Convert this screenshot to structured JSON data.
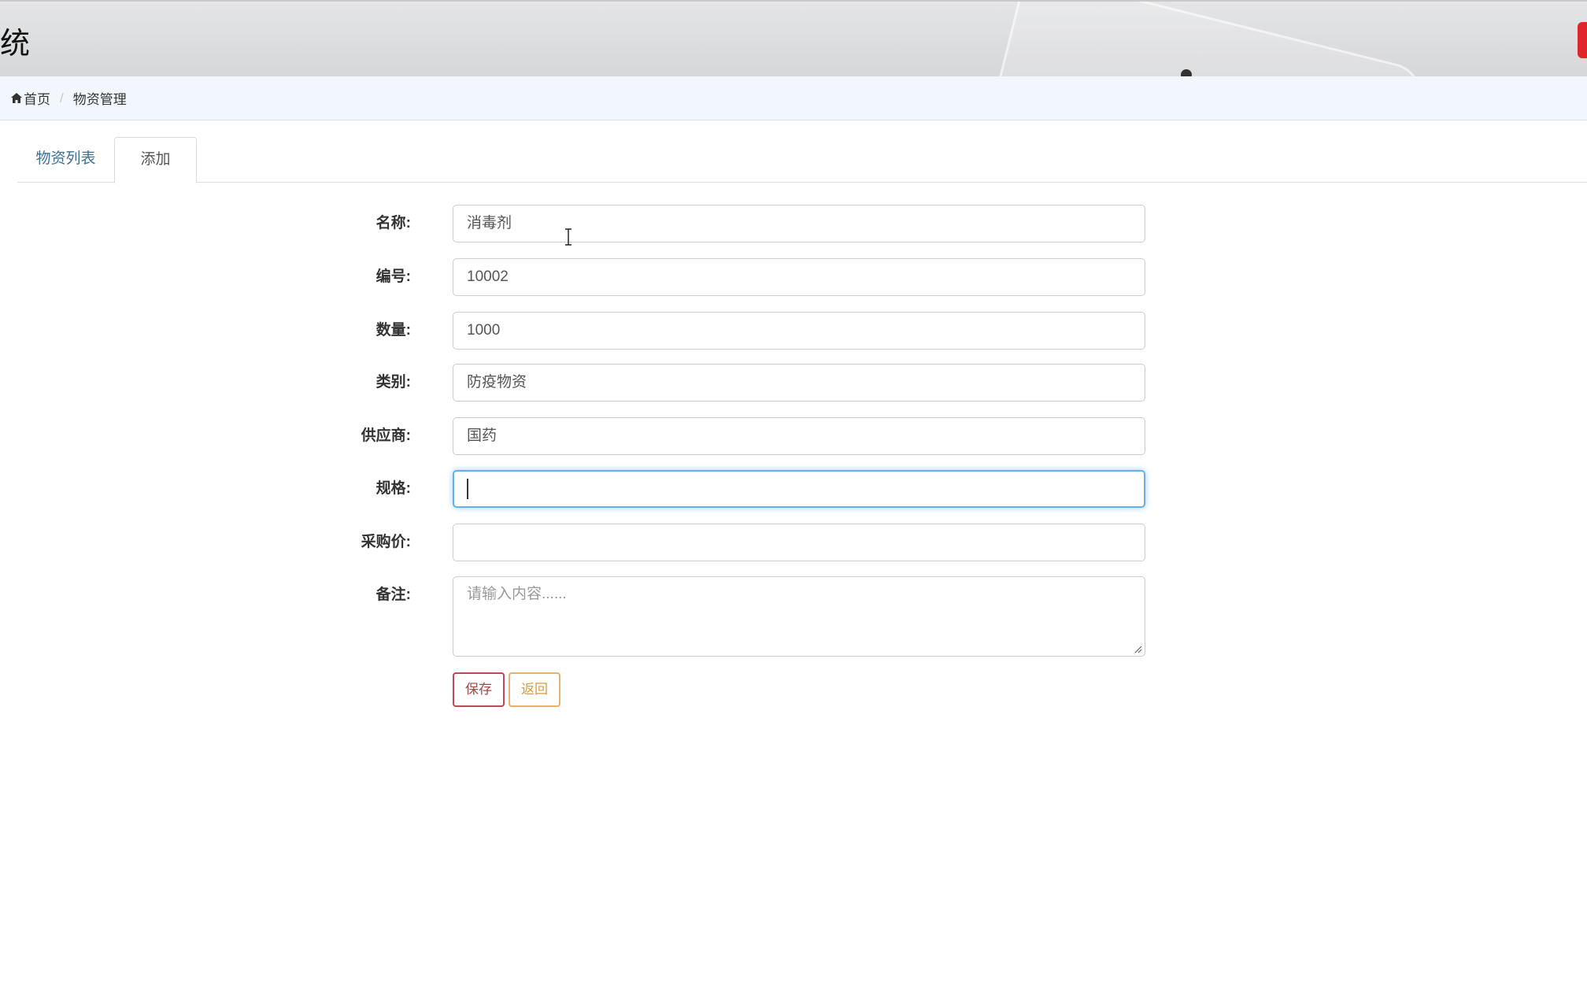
{
  "header": {
    "title_fragment": "统"
  },
  "breadcrumb": {
    "home": "首页",
    "current": "物资管理"
  },
  "tabs": {
    "list": "物资列表",
    "add": "添加"
  },
  "form": {
    "name": {
      "label": "名称:",
      "value": "消毒剂"
    },
    "code": {
      "label": "编号:",
      "value": "10002"
    },
    "quantity": {
      "label": "数量:",
      "value": "1000"
    },
    "category": {
      "label": "类别:",
      "value": "防疫物资"
    },
    "supplier": {
      "label": "供应商:",
      "value": "国药"
    },
    "spec": {
      "label": "规格:",
      "value": ""
    },
    "price": {
      "label": "采购价:",
      "value": ""
    },
    "remark": {
      "label": "备注:",
      "placeholder": "请输入内容......"
    }
  },
  "buttons": {
    "save": "保存",
    "back": "返回"
  },
  "colors": {
    "header_accent": "#e0262d",
    "link": "#3e6f95",
    "save_border": "#b94a5a",
    "back_border": "#e8b26a",
    "focus_border": "#66afe9"
  }
}
